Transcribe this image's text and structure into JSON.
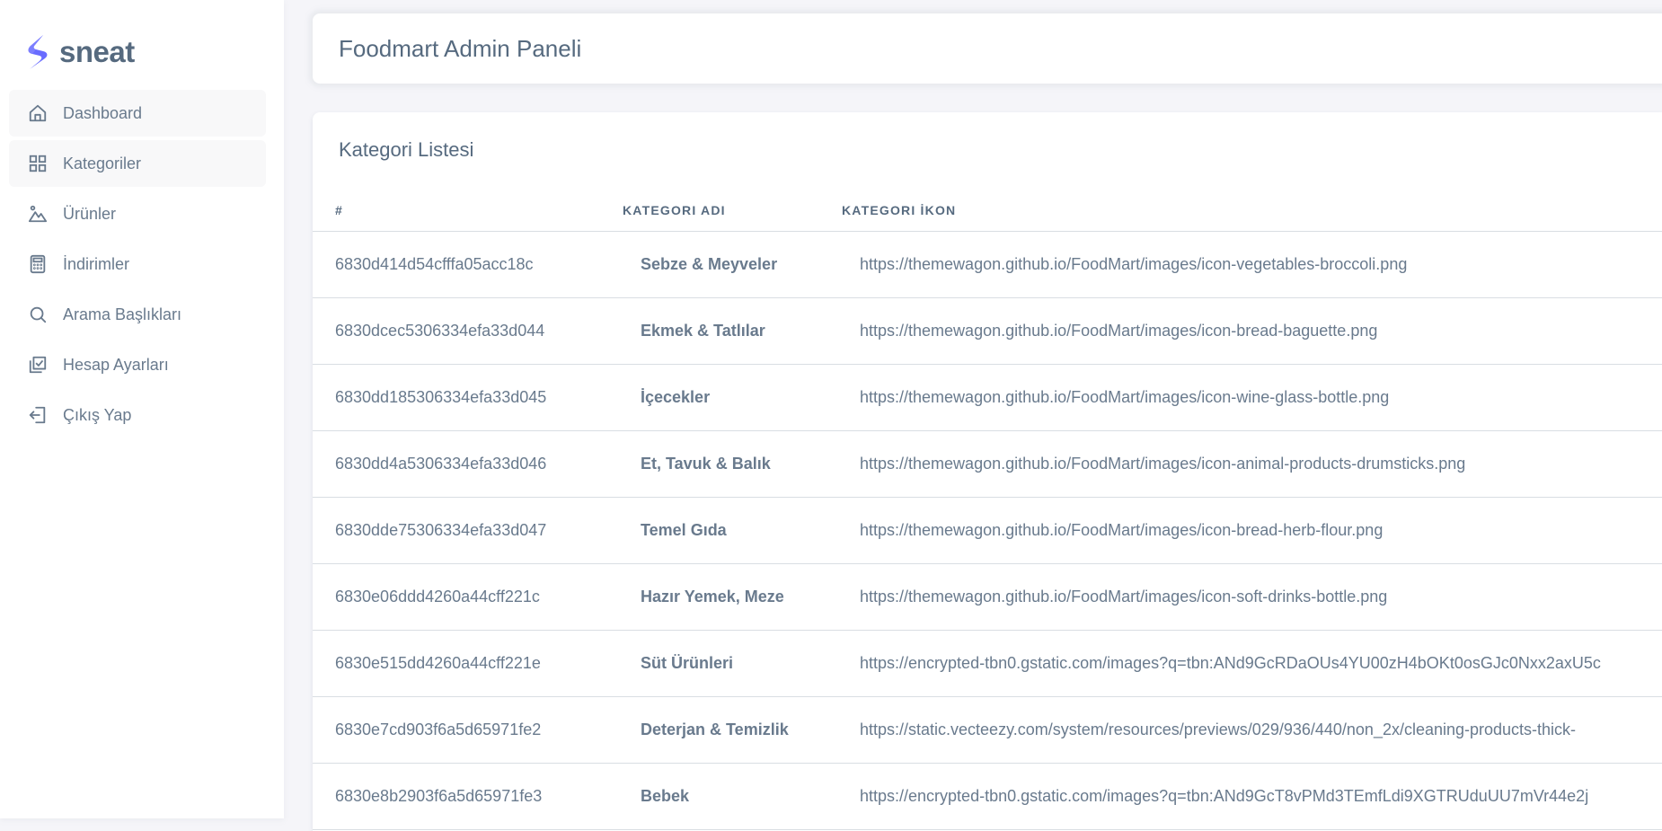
{
  "brand": {
    "name": "sneat",
    "accent": "#696cff"
  },
  "sidebar": {
    "items": [
      {
        "label": "Dashboard",
        "icon": "home-icon"
      },
      {
        "label": "Kategoriler",
        "icon": "grid-icon"
      },
      {
        "label": "Ürünler",
        "icon": "landscape-icon"
      },
      {
        "label": "İndirimler",
        "icon": "calculator-icon"
      },
      {
        "label": "Arama Başlıkları",
        "icon": "search-icon"
      },
      {
        "label": "Hesap Ayarları",
        "icon": "check-square-icon"
      },
      {
        "label": "Çıkış Yap",
        "icon": "logout-icon"
      }
    ]
  },
  "header": {
    "title": "Foodmart Admin Paneli"
  },
  "main": {
    "card_title": "Kategori Listesi",
    "table": {
      "columns": [
        "#",
        "KATEGORI ADI",
        "KATEGORI İKON"
      ],
      "rows": [
        {
          "id": "6830d414d54cfffa05acc18c",
          "name": "Sebze & Meyveler",
          "icon": "https://themewagon.github.io/FoodMart/images/icon-vegetables-broccoli.png"
        },
        {
          "id": "6830dcec5306334efa33d044",
          "name": "Ekmek & Tatlılar",
          "icon": "https://themewagon.github.io/FoodMart/images/icon-bread-baguette.png"
        },
        {
          "id": "6830dd185306334efa33d045",
          "name": "İçecekler",
          "icon": "https://themewagon.github.io/FoodMart/images/icon-wine-glass-bottle.png"
        },
        {
          "id": "6830dd4a5306334efa33d046",
          "name": "Et, Tavuk & Balık",
          "icon": "https://themewagon.github.io/FoodMart/images/icon-animal-products-drumsticks.png"
        },
        {
          "id": "6830dde75306334efa33d047",
          "name": "Temel Gıda",
          "icon": "https://themewagon.github.io/FoodMart/images/icon-bread-herb-flour.png"
        },
        {
          "id": "6830e06ddd4260a44cff221c",
          "name": "Hazır Yemek, Meze",
          "icon": "https://themewagon.github.io/FoodMart/images/icon-soft-drinks-bottle.png"
        },
        {
          "id": "6830e515dd4260a44cff221e",
          "name": "Süt Ürünleri",
          "icon": "https://encrypted-tbn0.gstatic.com/images?q=tbn:ANd9GcRDaOUs4YU00zH4bOKt0osGJc0Nxx2axU5c"
        },
        {
          "id": "6830e7cd903f6a5d65971fe2",
          "name": "Deterjan & Temizlik",
          "icon": "https://static.vecteezy.com/system/resources/previews/029/936/440/non_2x/cleaning-products-thick-"
        },
        {
          "id": "6830e8b2903f6a5d65971fe3",
          "name": "Bebek",
          "icon": "https://encrypted-tbn0.gstatic.com/images?q=tbn:ANd9GcT8vPMd3TEmfLdi9XGTRUduUU7mVr44e2j"
        }
      ]
    }
  }
}
